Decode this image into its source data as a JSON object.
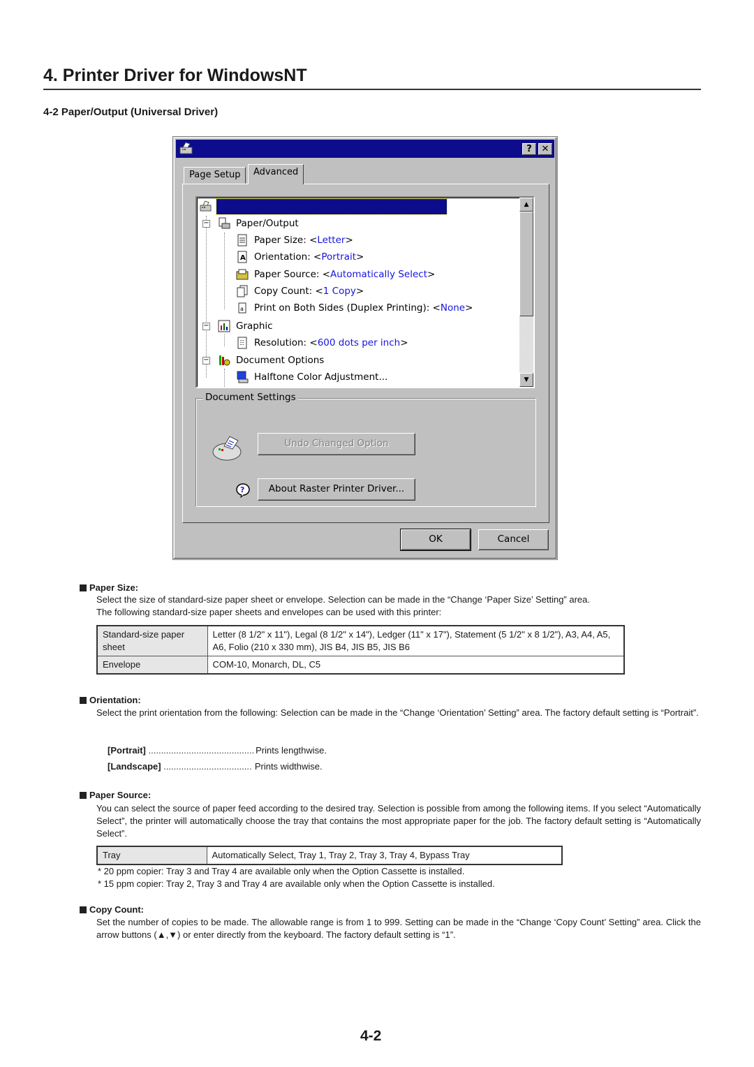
{
  "page": {
    "title": "4. Printer Driver for WindowsNT",
    "subtitle": "4-2 Paper/Output (Universal Driver)",
    "page_number": "4-2"
  },
  "dialog": {
    "titlebar": {
      "help_label": "?",
      "close_label": "✕"
    },
    "tabs": [
      {
        "label": "Page Setup",
        "active": false
      },
      {
        "label": "Advanced",
        "active": true
      }
    ],
    "tree": {
      "items": [
        {
          "label": "Paper/Output",
          "value": "",
          "icon": "paper-output-icon"
        },
        {
          "label": "Paper Size: <",
          "value": "Letter",
          "suffix": ">",
          "icon": "page-icon"
        },
        {
          "label": "Orientation: <",
          "value": "Portrait",
          "suffix": ">",
          "icon": "orientation-icon"
        },
        {
          "label": "Paper Source: <",
          "value": "Automatically Select",
          "suffix": ">",
          "icon": "tray-icon"
        },
        {
          "label": "Copy Count: <",
          "value": "1 Copy",
          "suffix": ">",
          "icon": "copies-icon"
        },
        {
          "label": "Print on Both Sides (Duplex Printing): <",
          "value": "None",
          "suffix": ">",
          "icon": "duplex-icon"
        },
        {
          "label": "Graphic",
          "value": "",
          "icon": "graphic-icon"
        },
        {
          "label": "Resolution: <",
          "value": "600 dots per inch",
          "suffix": ">",
          "icon": "resolution-icon"
        },
        {
          "label": "Document Options",
          "value": "",
          "icon": "document-options-icon"
        },
        {
          "label": "Halftone Color Adjustment...",
          "value": "",
          "icon": "halftone-icon"
        }
      ]
    },
    "document_settings": {
      "label": "Document Settings",
      "undo_button": "Undo Changed Option",
      "about_button": "About Raster Printer Driver..."
    },
    "ok_button": "OK",
    "cancel_button": "Cancel",
    "colors": {
      "titlebar": "#0c0c8c",
      "value_text": "#1515e0",
      "face": "#c0c0c0"
    }
  },
  "sections": {
    "paper_size": {
      "heading": "Paper Size:",
      "text1": "Select the size of standard-size paper sheet or envelope. Selection can be made in the “Change ‘Paper Size’ Setting” area.",
      "text2": "The following standard-size paper sheets and envelopes can be used with this printer:",
      "table": [
        {
          "type": "Standard-size paper sheet",
          "values": "Letter (8 1/2\" x 11\"), Legal (8 1/2\" x 14\"), Ledger  (11\" x 17\"), Statement (5 1/2\" x 8 1/2\"), A3, A4, A5, A6, Folio (210 x 330 mm), JIS B4, JIS B5, JIS B6"
        },
        {
          "type": "Envelope",
          "values": "COM-10, Monarch, DL, C5"
        }
      ]
    },
    "orientation": {
      "heading": "Orientation:",
      "text": "Select the print orientation from the following: Selection can be made in the “Change ‘Orientation’ Setting” area. The factory default setting is “Portrait”.",
      "options": [
        {
          "term": "[Portrait]",
          "desc": "Prints lengthwise."
        },
        {
          "term": "[Landscape]",
          "desc": "Prints widthwise."
        }
      ]
    },
    "paper_source": {
      "heading": "Paper Source:",
      "text": "You can select the source of paper feed according to the desired tray. Selection is possible from among the following items. If you select “Automatically Select”, the printer will automatically choose the tray that contains the most appropriate paper for the job. The factory default setting is “Automatically Select”.",
      "table": [
        {
          "type": "Tray",
          "values": "Automatically Select, Tray 1, Tray 2, Tray 3, Tray 4, Bypass Tray"
        }
      ],
      "notes": [
        "* 20 ppm copier: Tray 3 and Tray 4 are available only when the Option Cassette is installed.",
        "* 15 ppm copier: Tray 2, Tray 3 and Tray 4 are available only when the Option Cassette is installed."
      ]
    },
    "copy_count": {
      "heading": "Copy Count:",
      "text": "Set the number of copies to be made. The allowable range is from 1 to 999. Setting can be made in the “Change ‘Copy Count’ Setting” area. Click the arrow buttons (▲,▼) or enter directly from the keyboard. The factory default setting is “1”."
    }
  }
}
